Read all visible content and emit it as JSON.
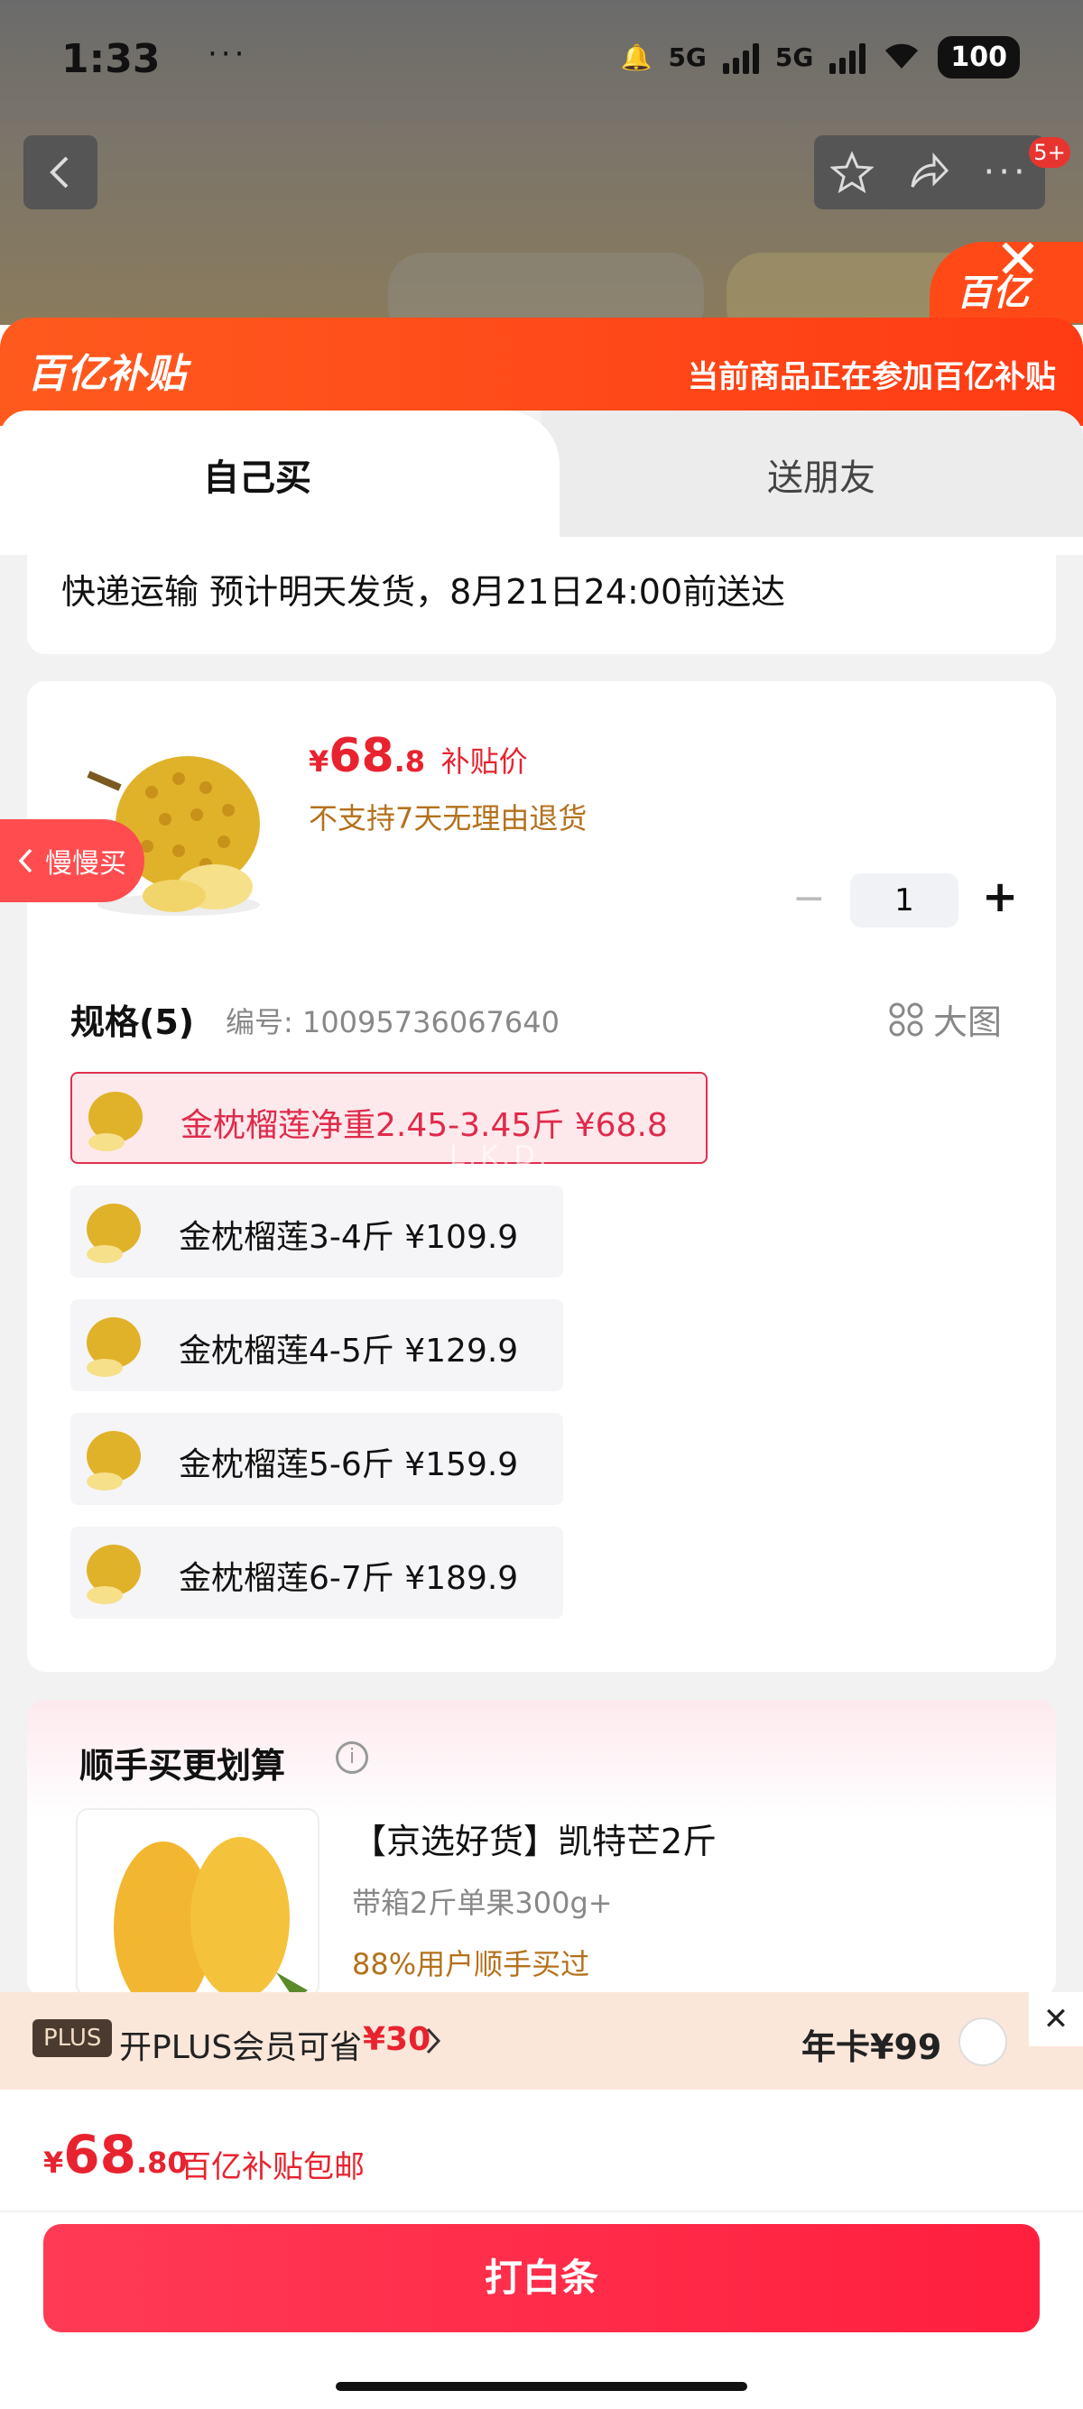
{
  "status_bar": {
    "time": "1:33",
    "dots": "···",
    "network": "5G",
    "battery": "100"
  },
  "banner": {
    "logo": "百亿补贴",
    "note": "当前商品正在参加百亿补贴",
    "side_badge": "百亿"
  },
  "top_nav": {
    "notification_count": "5+"
  },
  "tabs": [
    {
      "label": "自己买",
      "selected": true
    },
    {
      "label": "送朋友",
      "selected": false
    }
  ],
  "delivery": {
    "text": "快递运输 预计明天发货，8月21日24:00前送达"
  },
  "product": {
    "price_symbol": "¥",
    "price_int": "68",
    "price_dec": ".8",
    "price_tag": "补贴价",
    "return_note": "不支持7天无理由退货",
    "quantity": "1",
    "minus": "−",
    "plus": "+"
  },
  "side_pill": {
    "label": "慢慢买"
  },
  "spec": {
    "title": "规格(5)",
    "code_label": "编号: 10095736067640",
    "big_view": "大图",
    "options": [
      {
        "label": "金枕榴莲净重2.45-3.45斤   ¥68.8",
        "selected": true
      },
      {
        "label": "金枕榴莲3-4斤   ¥109.9",
        "selected": false
      },
      {
        "label": "金枕榴莲4-5斤   ¥129.9",
        "selected": false
      },
      {
        "label": "金枕榴莲5-6斤   ¥159.9",
        "selected": false
      },
      {
        "label": "金枕榴莲6-7斤   ¥189.9",
        "selected": false
      }
    ]
  },
  "watermark": "L.K.D.",
  "addon": {
    "title": "顺手买更划算",
    "item_title": "【京选好货】凯特芒2斤",
    "item_spec": "带箱2斤单果300g+",
    "item_note": "88%用户顺手买过"
  },
  "plus": {
    "badge": "PLUS",
    "text": "开PLUS会员可省",
    "save": "¥30",
    "annual": "年卡¥99"
  },
  "footer": {
    "price_symbol": "¥",
    "price_int": "68",
    "price_dec": ".80",
    "note": "百亿补贴包邮",
    "buy_label": "打白条"
  },
  "colors": {
    "brand_red": "#ff2d46",
    "banner_orange": "#ff4a18",
    "price_red": "#e8232f",
    "note_brown": "#b4711c"
  }
}
